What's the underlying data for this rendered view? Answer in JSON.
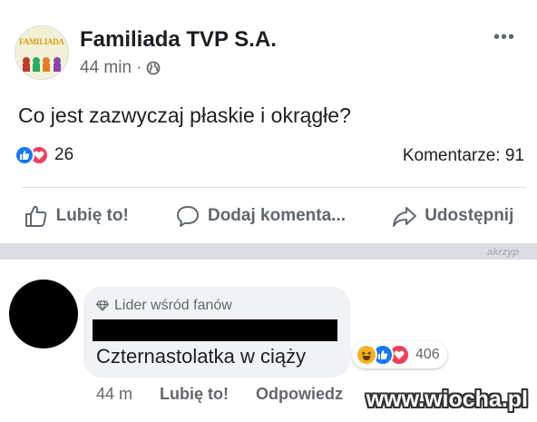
{
  "post": {
    "page_name": "Familiada TVP S.A.",
    "avatar_text": "FAMILIADA",
    "time": "44 min",
    "separator_dot": "·",
    "text": "Co jest zazwyczaj płaskie i okrągłe?",
    "reactions_count": "26",
    "comments_label": "Komentarze: 91",
    "reaction_icons": [
      "like-icon",
      "love-icon"
    ]
  },
  "actions": {
    "like_label": "Lubię to!",
    "comment_label": "Dodaj komenta...",
    "share_label": "Udostępnij"
  },
  "watermark_small": "akrzyp",
  "comment": {
    "badge_label": "Lider wśród fanów",
    "text": "Czternastolatka w ciąży",
    "reactions_count": "406",
    "reaction_icons": [
      "haha-icon",
      "like-icon",
      "love-icon"
    ],
    "time": "44 m",
    "like_link": "Lubię to!",
    "reply_link": "Odpowiedz"
  },
  "site_watermark": "www.wiocha.pl",
  "colors": {
    "like": "#1877f2",
    "love": "#f33e58",
    "haha": "#f7b125",
    "secondary_text": "#65676b",
    "bubble_bg": "#f0f2f5"
  }
}
